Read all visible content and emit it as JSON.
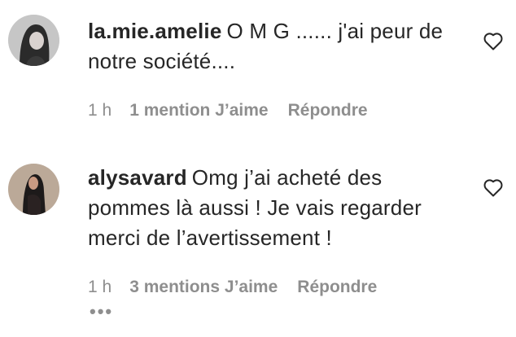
{
  "comments": [
    {
      "username": "la.mie.amelie",
      "text": "O M G ...... j'ai peur de notre société....",
      "time": "1 h",
      "likes": "1 mention J’aime",
      "reply": "Répondre",
      "like_icon": "heart-outline-icon"
    },
    {
      "username": "alysavard",
      "text": "Omg j’ai acheté des pommes là aussi ! Je vais regarder merci de l’avertissement !",
      "time": "1 h",
      "likes": "3 mentions J’aime",
      "reply": "Répondre",
      "like_icon": "heart-outline-icon"
    }
  ],
  "more_indicator": "•••",
  "colors": {
    "text": "#262626",
    "secondary": "#8e8e8e",
    "background": "#ffffff"
  }
}
